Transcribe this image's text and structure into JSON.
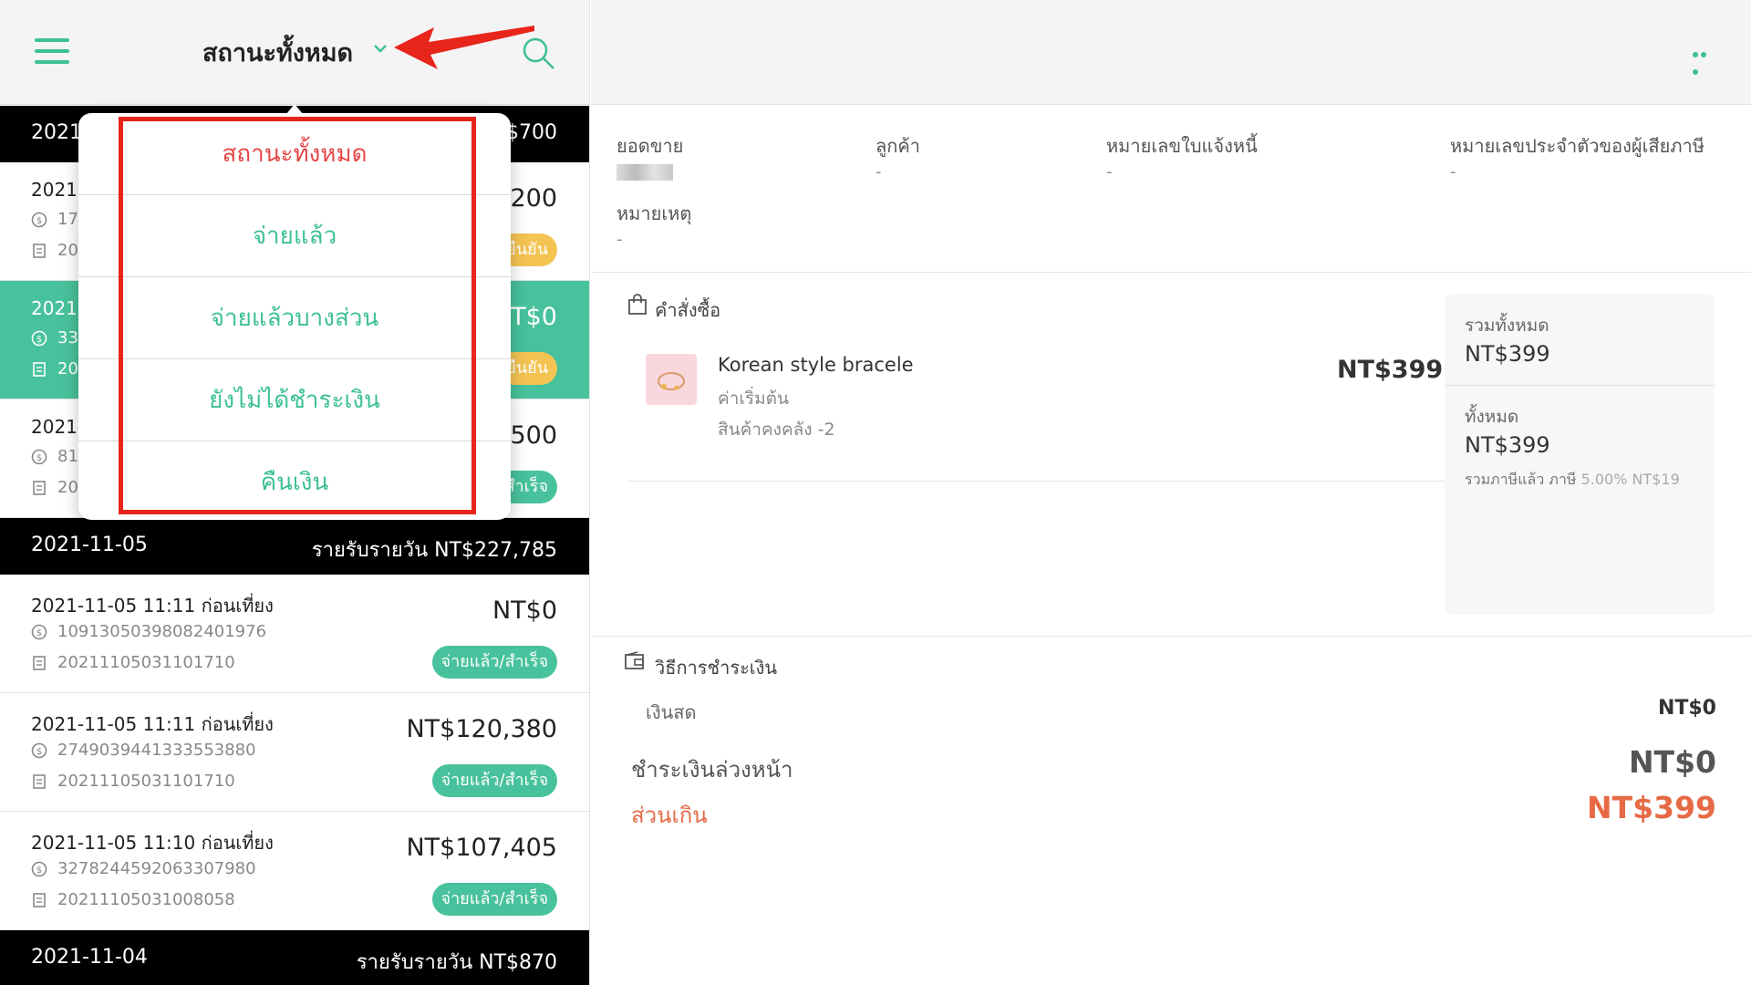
{
  "header": {
    "status_title": "สถานะทั้งหมด"
  },
  "groups": [
    {
      "date": "2021",
      "total": "$700"
    },
    {
      "date": "2021-11-05",
      "total": "รายรับรายวัน  NT$227,785"
    },
    {
      "date": "2021-11-04",
      "total": "รายรับรายวัน  NT$870"
    }
  ],
  "rows": [
    {
      "time": "2021-",
      "id": "17",
      "inv": "20",
      "amount": "$200",
      "badge": "ยืนยัน",
      "state": "pending"
    },
    {
      "time": "2021-",
      "id": "33",
      "inv": "20",
      "amount": "T$0",
      "badge": "ยืนยัน",
      "state": "active"
    },
    {
      "time": "2021-",
      "id": "81",
      "inv": "20",
      "amount": "$500",
      "badge": "สำเร็จ",
      "state": "normal"
    },
    {
      "time": "2021-11-05 11:11 ก่อนเที่ยง",
      "id": "10913050398082401976",
      "inv": "20211105031101710",
      "amount": "NT$0",
      "badge": "จ่ายแล้ว/สำเร็จ",
      "state": "normal"
    },
    {
      "time": "2021-11-05 11:11 ก่อนเที่ยง",
      "id": "2749039441333553880",
      "inv": "20211105031101710",
      "amount": "NT$120,380",
      "badge": "จ่ายแล้ว/สำเร็จ",
      "state": "normal"
    },
    {
      "time": "2021-11-05 11:10 ก่อนเที่ยง",
      "id": "3278244592063307980",
      "inv": "20211105031008058",
      "amount": "NT$107,405",
      "badge": "จ่ายแล้ว/สำเร็จ",
      "state": "normal"
    }
  ],
  "dropdown": {
    "items": [
      "สถานะทั้งหมด",
      "จ่ายแล้ว",
      "จ่ายแล้วบางส่วน",
      "ยังไม่ได้ชำระเงิน",
      "คืนเงิน"
    ],
    "selected_index": 0
  },
  "detail": {
    "sales_label": "ยอดขาย",
    "customer_label": "ลูกค้า",
    "customer_value": "-",
    "invoice_label": "หมายเลขใบแจ้งหนี้",
    "invoice_value": "-",
    "taxid_label": "หมายเลขประจำตัวของผู้เสียภาษี",
    "taxid_value": "-",
    "note_label": "หมายเหตุ",
    "note_value": "-",
    "order_section": "คำสั่งซื้อ",
    "product": {
      "name": "Korean style bracele",
      "variant": "ค่าเริ่มต้น",
      "stock": "สินค้าคงคลัง -2",
      "price": "NT$399"
    },
    "summary": {
      "subtotal_label": "รวมทั้งหมด",
      "subtotal_value": "NT$399",
      "total_label": "ทั้งหมด",
      "total_value": "NT$399",
      "tax_label": "รวมภาษีแล้ว ภาษี",
      "tax_value": "5.00% NT$19"
    },
    "payment_section": "วิธีการชำระเงิน",
    "cash_label": "เงินสด",
    "cash_value": "NT$0",
    "prepaid_label": "ชำระเงินล่วงหน้า",
    "prepaid_value": "NT$0",
    "overpay_label": "ส่วนเกิน",
    "overpay_value": "NT$399"
  },
  "colors": {
    "accent": "#3dbf97",
    "active_row": "#48c29c",
    "pending_badge": "#f4c453",
    "highlight_frame": "#e8251b",
    "overpay": "#e66a45"
  }
}
